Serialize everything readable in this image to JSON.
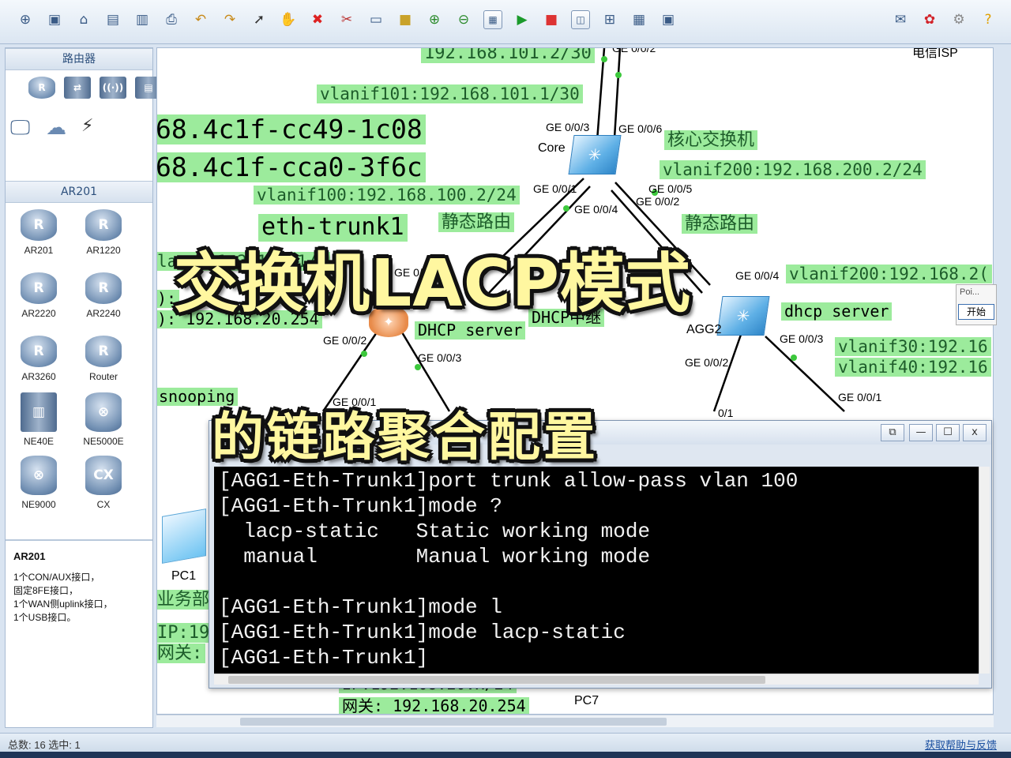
{
  "toolbar": {
    "icons": [
      "new-topology-icon",
      "new-icon",
      "open-icon",
      "save-icon",
      "save-as-icon",
      "print-icon",
      "undo-icon",
      "redo-icon",
      "select-icon",
      "pan-hand-icon",
      "delete-icon",
      "delete-link-icon",
      "text-note-icon",
      "rectangle-icon",
      "zoom-in-icon",
      "zoom-out-icon",
      "topology-icon",
      "start-icon",
      "stop-icon",
      "capture-icon",
      "grid-icon",
      "table-icon",
      "console-icon"
    ],
    "right_icons": [
      "chat-icon",
      "huawei-logo-icon",
      "settings-gear-icon",
      "help-icon"
    ]
  },
  "left_panel": {
    "router_header": "路由器",
    "category_icons": [
      "router-category-icon",
      "switch-category-icon",
      "wireless-category-icon",
      "firewall-category-icon",
      "pc-category-icon",
      "cloud-category-icon",
      "power-category-icon"
    ],
    "series_header": "AR201",
    "devices": [
      {
        "label": "AR201"
      },
      {
        "label": "AR1220"
      },
      {
        "label": "AR2220"
      },
      {
        "label": "AR2240"
      },
      {
        "label": "AR3260"
      },
      {
        "label": "Router"
      },
      {
        "label": "NE40E"
      },
      {
        "label": "NE5000E"
      },
      {
        "label": "NE9000"
      },
      {
        "label": "CX"
      }
    ],
    "description": {
      "title": "AR201",
      "lines": [
        "1个CON/AUX接口，",
        "固定8FE接口，",
        "1个WAN侧uplink接口，",
        "1个USB接口。"
      ]
    }
  },
  "canvas": {
    "green_labels": {
      "ip_top": "192.168.101.2/30",
      "vlanif101": "vlanif101:192.168.101.1/30",
      "mac1": "68.4c1f-cc49-1c08",
      "mac2": "68.4c1f-cca0-3f6c",
      "vlanif100": "vlanif100:192.168.100.2/24",
      "eth_trunk": "eth-trunk1",
      "static_route_left": "静态路由",
      "core_switch": "核心交换机",
      "vlanif200_core": "vlanif200:192.168.200.2/24",
      "static_route_right": "静态路由",
      "vlanif200_agg2": "vlanif200:192.168.2(",
      "dhcp_server_right": "dhcp server",
      "vlanif30": "vlanif30:192.16",
      "vlanif40": "vlanif40:192.16",
      "dhcp_server_left": "DHCP server",
      "dhcp_relay": "DHCP中继",
      "left_ip_partial": "lan 0:1 2:100.1/2",
      "left_gw": "): 192.168.20.254",
      "left_colon": "):",
      "snooping": "snooping",
      "business_dept": "业务部4",
      "ip_19": "IP:19",
      "gw_short": "网关:",
      "bottom_ip": "IP:192.168.20.x/24",
      "bottom_gw": "网关: 192.168.20.254"
    },
    "ports": {
      "top_ge002": "GE 0/0/2",
      "ge003_core": "GE 0/0/3",
      "ge006": "GE 0/0/6",
      "ge001_core": "GE 0/0/1",
      "ge004_core": "GE 0/0/4",
      "ge005": "GE 0/0/5",
      "ge002_core": "GE 0/0/2",
      "ge0_1": "GE 0/0/1",
      "ge004_agg2": "GE 0/0/4",
      "ge003_agg2": "GE 0/0/3",
      "ge002_agg2": "GE 0/0/2",
      "ge001_right": "GE 0/0/1",
      "ge002_agg1": "GE 0/0/2",
      "ge003_agg1": "GE 0/0/3",
      "ge_0_1_agg1": "GE 0/0/1",
      "ge_01_agg2_low": "0/1"
    },
    "nodes": {
      "core": "Core",
      "agg2": "AGG2",
      "isp": "电信ISP",
      "pc1": "PC1",
      "pc7": "PC7"
    }
  },
  "overlay": {
    "line1": "交换机LACP模式",
    "line2": "的链路聚合配置"
  },
  "terminal": {
    "lines": [
      "[AGG1-Eth-Trunk1]port trunk allow-pass vlan 100",
      "[AGG1-Eth-Trunk1]mode ?",
      "  lacp-static   Static working mode",
      "  manual        Manual working mode",
      "",
      "[AGG1-Eth-Trunk1]mode l",
      "[AGG1-Eth-Trunk1]mode lacp-static",
      "[AGG1-Eth-Trunk1]"
    ],
    "buttons": {
      "restore": "⧉",
      "minimize": "—",
      "maximize": "☐",
      "close": "x"
    }
  },
  "poi_popup": {
    "title": "Poi...",
    "start_button": "开始"
  },
  "status": {
    "count_text": "总数: 16  选中: 1",
    "help_link": "获取帮助与反馈"
  },
  "colors": {
    "label_green": "#9ceb9c",
    "overlay_yellow": "#fff7a0"
  }
}
